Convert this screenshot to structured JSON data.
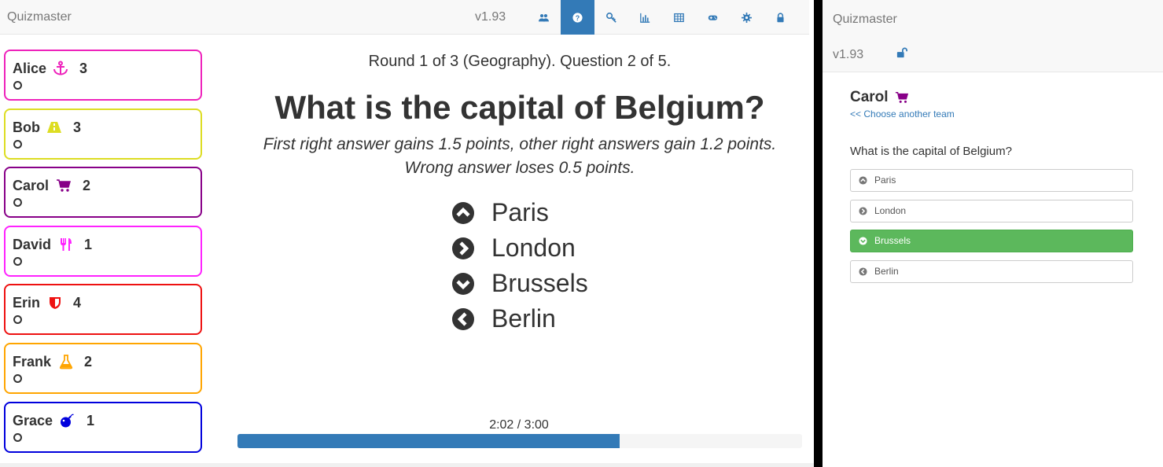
{
  "main": {
    "brand": "Quizmaster",
    "version": "v1.93",
    "nav_icons": [
      "users-icon",
      "question-icon",
      "key-icon",
      "bar-chart-icon",
      "table-icon",
      "gamepad-icon",
      "gear-icon",
      "lock-icon"
    ],
    "active_nav": "question-icon",
    "teams": [
      {
        "name": "Alice",
        "icon": "anchor-icon",
        "score": "3",
        "color": "#ee22bb"
      },
      {
        "name": "Bob",
        "icon": "road-icon",
        "score": "3",
        "color": "#dddd22"
      },
      {
        "name": "Carol",
        "icon": "shopping-cart-icon",
        "score": "2",
        "color": "#880088"
      },
      {
        "name": "David",
        "icon": "cutlery-icon",
        "score": "1",
        "color": "#ff22ff"
      },
      {
        "name": "Erin",
        "icon": "shield-icon",
        "score": "4",
        "color": "#ee1111"
      },
      {
        "name": "Frank",
        "icon": "flask-icon",
        "score": "2",
        "color": "#ffa500"
      },
      {
        "name": "Grace",
        "icon": "bomb-icon",
        "score": "1",
        "color": "#0000dd"
      }
    ],
    "round_info": "Round 1 of 3 (Geography). Question 2 of 5.",
    "question": "What is the capital of Belgium?",
    "scoring_line1": "First right answer gains 1.5 points, other right answers gain 1.2 points.",
    "scoring_line2": "Wrong answer loses 0.5 points.",
    "answers": [
      {
        "text": "Paris",
        "icon": "chevron-up-circle-icon"
      },
      {
        "text": "London",
        "icon": "chevron-right-circle-icon"
      },
      {
        "text": "Brussels",
        "icon": "chevron-down-circle-icon"
      },
      {
        "text": "Berlin",
        "icon": "chevron-left-circle-icon"
      }
    ],
    "timer_text": "2:02 / 3:00",
    "timer_progress": 0.677
  },
  "player": {
    "brand": "Quizmaster",
    "version": "v1.93",
    "lock_icon": "unlocked-icon",
    "team_name": "Carol",
    "team_icon": "shopping-cart-icon",
    "team_color": "#880088",
    "choose_link": "<< Choose another team",
    "question": "What is the capital of Belgium?",
    "answers": [
      {
        "text": "Paris",
        "icon": "chevron-up-circle-icon",
        "selected": false
      },
      {
        "text": "London",
        "icon": "chevron-right-circle-icon",
        "selected": false
      },
      {
        "text": "Brussels",
        "icon": "chevron-down-circle-icon",
        "selected": true
      },
      {
        "text": "Berlin",
        "icon": "chevron-left-circle-icon",
        "selected": false
      }
    ]
  },
  "colors": {
    "primary": "#337ab7",
    "success": "#5cb85c"
  }
}
